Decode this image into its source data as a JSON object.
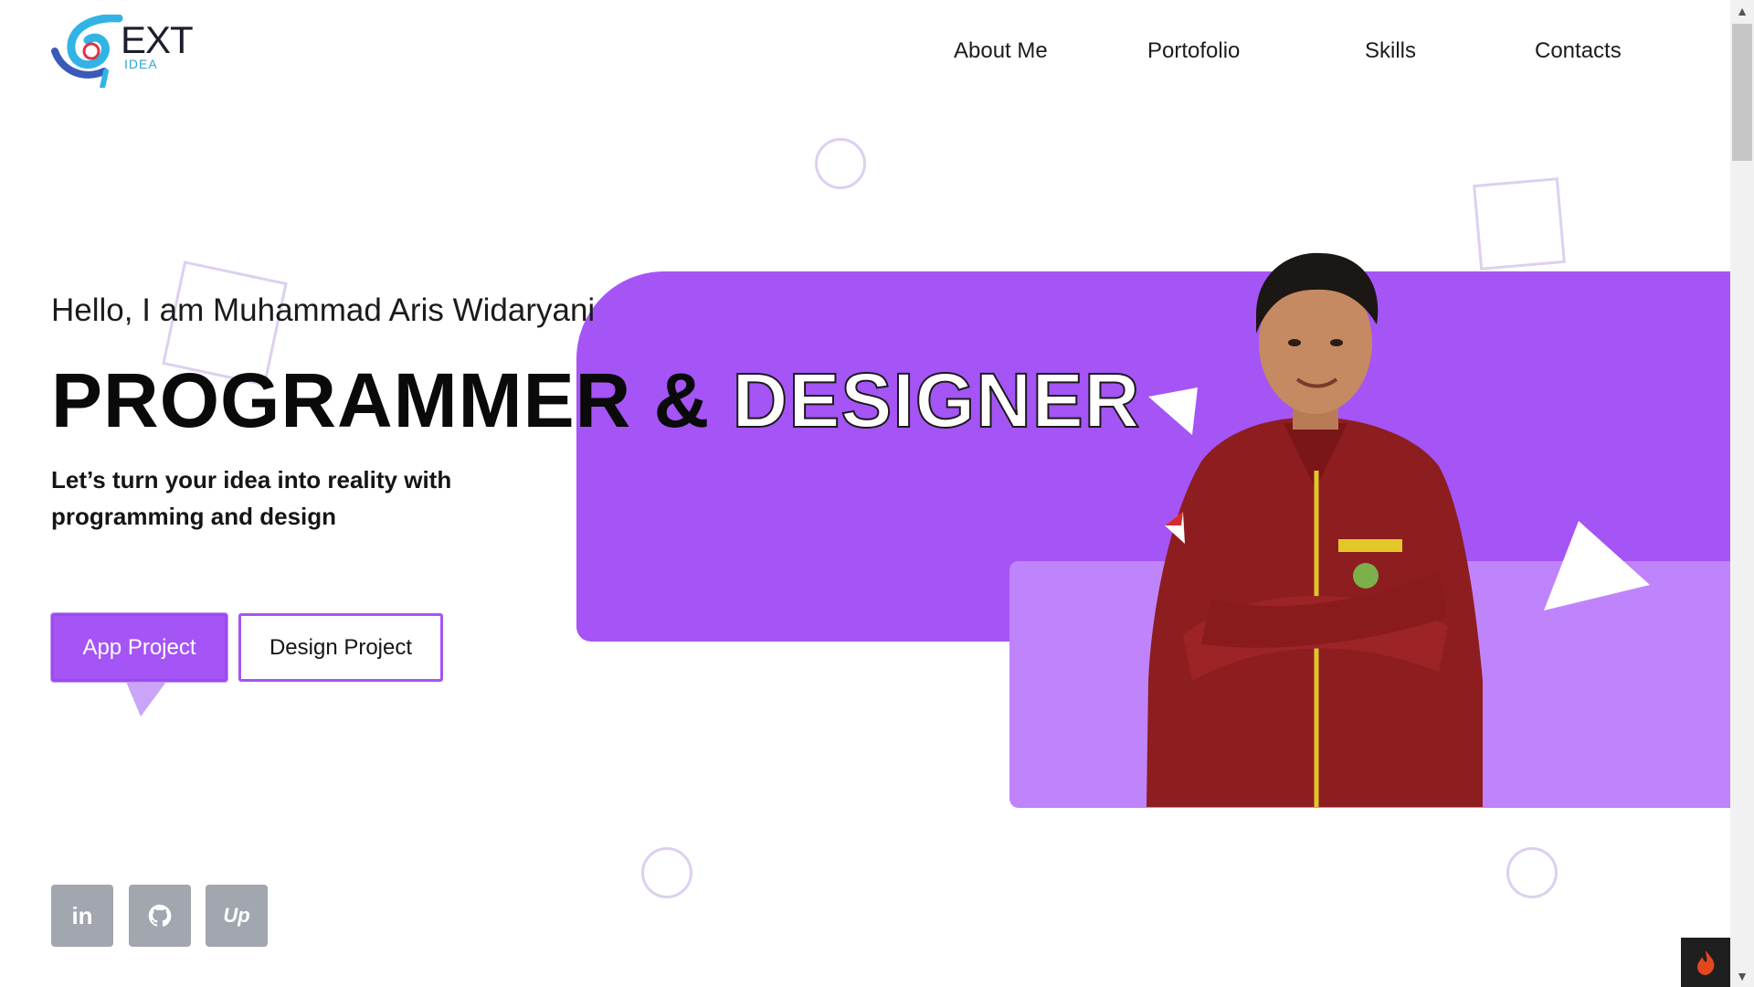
{
  "brand": {
    "name": "EXT",
    "sub": "IDEA"
  },
  "nav": {
    "items": [
      "About Me",
      "Portofolio",
      "Skills",
      "Contacts"
    ]
  },
  "hero": {
    "greeting": "Hello, I am Muhammad Aris Widaryani",
    "headline_part1": "PROGRAMMER &",
    "headline_part2": "DESIGNER",
    "tagline": "Let’s turn your idea into reality with programming and design",
    "primary_button": "App Project",
    "secondary_button": "Design Project"
  },
  "social": [
    {
      "icon": "linkedin-icon",
      "label": "in"
    },
    {
      "icon": "github-icon",
      "label": ""
    },
    {
      "icon": "upwork-icon",
      "label": "Up"
    }
  ],
  "colors": {
    "accent": "#a554f6",
    "accent_light": "#bf84fb",
    "social_bg": "#a2a6ae"
  }
}
